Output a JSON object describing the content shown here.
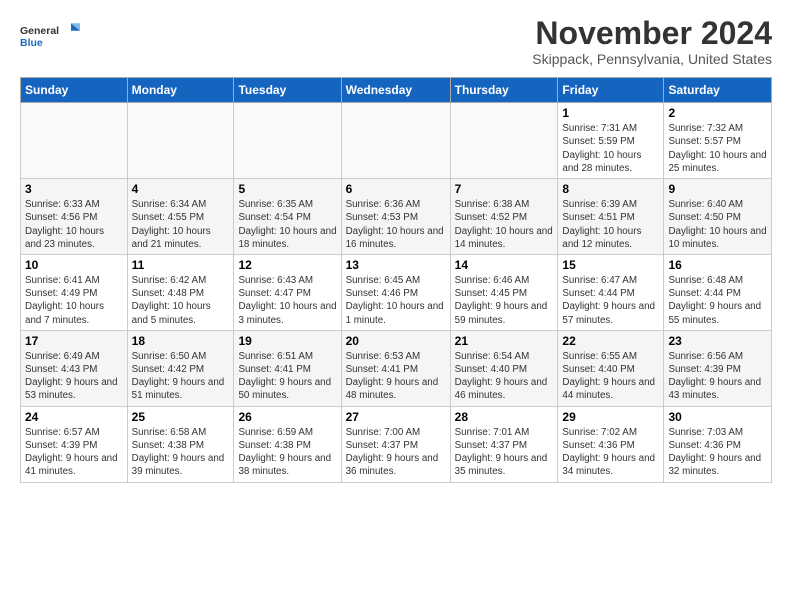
{
  "header": {
    "logo_line1": "General",
    "logo_line2": "Blue",
    "month": "November 2024",
    "location": "Skippack, Pennsylvania, United States"
  },
  "weekdays": [
    "Sunday",
    "Monday",
    "Tuesday",
    "Wednesday",
    "Thursday",
    "Friday",
    "Saturday"
  ],
  "weeks": [
    [
      {
        "day": "",
        "info": ""
      },
      {
        "day": "",
        "info": ""
      },
      {
        "day": "",
        "info": ""
      },
      {
        "day": "",
        "info": ""
      },
      {
        "day": "",
        "info": ""
      },
      {
        "day": "1",
        "info": "Sunrise: 7:31 AM\nSunset: 5:59 PM\nDaylight: 10 hours and 28 minutes."
      },
      {
        "day": "2",
        "info": "Sunrise: 7:32 AM\nSunset: 5:57 PM\nDaylight: 10 hours and 25 minutes."
      }
    ],
    [
      {
        "day": "3",
        "info": "Sunrise: 6:33 AM\nSunset: 4:56 PM\nDaylight: 10 hours and 23 minutes."
      },
      {
        "day": "4",
        "info": "Sunrise: 6:34 AM\nSunset: 4:55 PM\nDaylight: 10 hours and 21 minutes."
      },
      {
        "day": "5",
        "info": "Sunrise: 6:35 AM\nSunset: 4:54 PM\nDaylight: 10 hours and 18 minutes."
      },
      {
        "day": "6",
        "info": "Sunrise: 6:36 AM\nSunset: 4:53 PM\nDaylight: 10 hours and 16 minutes."
      },
      {
        "day": "7",
        "info": "Sunrise: 6:38 AM\nSunset: 4:52 PM\nDaylight: 10 hours and 14 minutes."
      },
      {
        "day": "8",
        "info": "Sunrise: 6:39 AM\nSunset: 4:51 PM\nDaylight: 10 hours and 12 minutes."
      },
      {
        "day": "9",
        "info": "Sunrise: 6:40 AM\nSunset: 4:50 PM\nDaylight: 10 hours and 10 minutes."
      }
    ],
    [
      {
        "day": "10",
        "info": "Sunrise: 6:41 AM\nSunset: 4:49 PM\nDaylight: 10 hours and 7 minutes."
      },
      {
        "day": "11",
        "info": "Sunrise: 6:42 AM\nSunset: 4:48 PM\nDaylight: 10 hours and 5 minutes."
      },
      {
        "day": "12",
        "info": "Sunrise: 6:43 AM\nSunset: 4:47 PM\nDaylight: 10 hours and 3 minutes."
      },
      {
        "day": "13",
        "info": "Sunrise: 6:45 AM\nSunset: 4:46 PM\nDaylight: 10 hours and 1 minute."
      },
      {
        "day": "14",
        "info": "Sunrise: 6:46 AM\nSunset: 4:45 PM\nDaylight: 9 hours and 59 minutes."
      },
      {
        "day": "15",
        "info": "Sunrise: 6:47 AM\nSunset: 4:44 PM\nDaylight: 9 hours and 57 minutes."
      },
      {
        "day": "16",
        "info": "Sunrise: 6:48 AM\nSunset: 4:44 PM\nDaylight: 9 hours and 55 minutes."
      }
    ],
    [
      {
        "day": "17",
        "info": "Sunrise: 6:49 AM\nSunset: 4:43 PM\nDaylight: 9 hours and 53 minutes."
      },
      {
        "day": "18",
        "info": "Sunrise: 6:50 AM\nSunset: 4:42 PM\nDaylight: 9 hours and 51 minutes."
      },
      {
        "day": "19",
        "info": "Sunrise: 6:51 AM\nSunset: 4:41 PM\nDaylight: 9 hours and 50 minutes."
      },
      {
        "day": "20",
        "info": "Sunrise: 6:53 AM\nSunset: 4:41 PM\nDaylight: 9 hours and 48 minutes."
      },
      {
        "day": "21",
        "info": "Sunrise: 6:54 AM\nSunset: 4:40 PM\nDaylight: 9 hours and 46 minutes."
      },
      {
        "day": "22",
        "info": "Sunrise: 6:55 AM\nSunset: 4:40 PM\nDaylight: 9 hours and 44 minutes."
      },
      {
        "day": "23",
        "info": "Sunrise: 6:56 AM\nSunset: 4:39 PM\nDaylight: 9 hours and 43 minutes."
      }
    ],
    [
      {
        "day": "24",
        "info": "Sunrise: 6:57 AM\nSunset: 4:39 PM\nDaylight: 9 hours and 41 minutes."
      },
      {
        "day": "25",
        "info": "Sunrise: 6:58 AM\nSunset: 4:38 PM\nDaylight: 9 hours and 39 minutes."
      },
      {
        "day": "26",
        "info": "Sunrise: 6:59 AM\nSunset: 4:38 PM\nDaylight: 9 hours and 38 minutes."
      },
      {
        "day": "27",
        "info": "Sunrise: 7:00 AM\nSunset: 4:37 PM\nDaylight: 9 hours and 36 minutes."
      },
      {
        "day": "28",
        "info": "Sunrise: 7:01 AM\nSunset: 4:37 PM\nDaylight: 9 hours and 35 minutes."
      },
      {
        "day": "29",
        "info": "Sunrise: 7:02 AM\nSunset: 4:36 PM\nDaylight: 9 hours and 34 minutes."
      },
      {
        "day": "30",
        "info": "Sunrise: 7:03 AM\nSunset: 4:36 PM\nDaylight: 9 hours and 32 minutes."
      }
    ]
  ]
}
